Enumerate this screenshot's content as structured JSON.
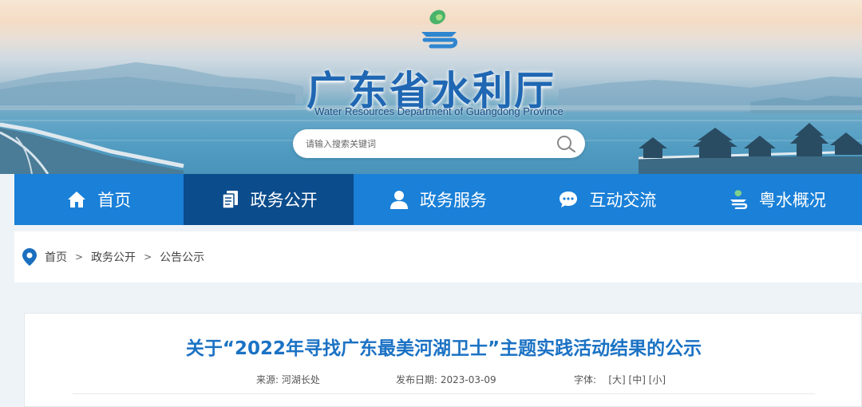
{
  "site": {
    "title": "广东省水利厅",
    "subtitle": "Water Resources Department of Guangdong Province"
  },
  "search": {
    "placeholder": "请输入搜索关键词"
  },
  "nav": {
    "items": [
      {
        "label": "首页",
        "icon": "home-icon",
        "active": false
      },
      {
        "label": "政务公开",
        "icon": "document-icon",
        "active": true
      },
      {
        "label": "政务服务",
        "icon": "user-icon",
        "active": false
      },
      {
        "label": "互动交流",
        "icon": "chat-icon",
        "active": false
      },
      {
        "label": "粤水概况",
        "icon": "yue-logo-icon",
        "active": false
      }
    ]
  },
  "breadcrumb": {
    "icon": "location-pin-icon",
    "items": [
      "首页",
      "政务公开",
      "公告公示"
    ],
    "separator": ">"
  },
  "article": {
    "title": "关于“2022年寻找广东最美河湖卫士”主题实践活动结果的公示",
    "source_label": "来源:",
    "source_value": "河湖长处",
    "date_label": "发布日期:",
    "date_value": "2023-03-09",
    "font_label": "字体:",
    "font_sizes": [
      "[大]",
      "[中]",
      "[小]"
    ]
  },
  "colors": {
    "nav_bg": "#1a80d8",
    "nav_active_bg": "#0b4c8c",
    "title_blue": "#1f67b3",
    "article_title": "#1b72c4"
  }
}
